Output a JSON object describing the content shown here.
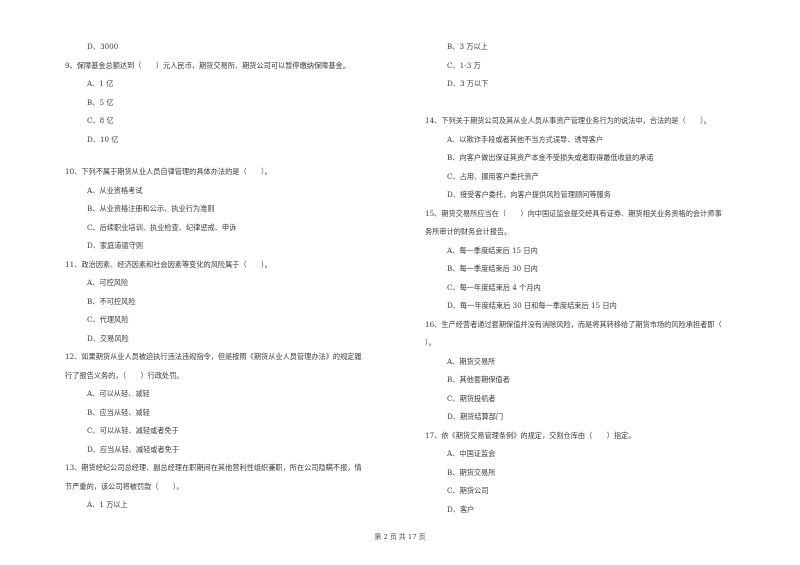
{
  "left_column": [
    {
      "text": "D、3000",
      "type": "option"
    },
    {
      "text": "9、保障基金总额达到（　　）元人民币，期货交易所、期货公司可以暂停缴纳保障基金。",
      "type": "question"
    },
    {
      "text": "A、1 亿",
      "type": "option"
    },
    {
      "text": "B、5 亿",
      "type": "option"
    },
    {
      "text": "C、8 亿",
      "type": "option"
    },
    {
      "text": "D、10 亿",
      "type": "option"
    },
    {
      "text": "10、下列不属于期货从业人员自律管理的具体办法的是（　　）。",
      "type": "question"
    },
    {
      "text": "A、从业资格考试",
      "type": "option"
    },
    {
      "text": "B、从业资格注册和公示、执业行为准则",
      "type": "option"
    },
    {
      "text": "C、后续职业培训、执业检查、纪律惩戒、申诉",
      "type": "option"
    },
    {
      "text": "D、家庭道德守则",
      "type": "option"
    },
    {
      "text": "11、政治因素、经济因素和社会因素等变化的风险属于（　　）。",
      "type": "question"
    },
    {
      "text": "A、可控风险",
      "type": "option"
    },
    {
      "text": "B、不可控风险",
      "type": "option"
    },
    {
      "text": "C、代理风险",
      "type": "option"
    },
    {
      "text": "D、交易风险",
      "type": "option"
    },
    {
      "text": "12、如果期货从业人员被迫执行违法违规指令，但是按照《期货从业人员管理办法》的规定履",
      "type": "question"
    },
    {
      "text": "行了报告义务的，（　　）行政处罚。",
      "type": "question-cont"
    },
    {
      "text": "A、可以从轻、减轻",
      "type": "option"
    },
    {
      "text": "B、应当从轻、减轻",
      "type": "option"
    },
    {
      "text": "C、可以从轻、减轻或者免于",
      "type": "option"
    },
    {
      "text": "D、应当从轻、减轻或者免于",
      "type": "option"
    },
    {
      "text": "13、期货经纪公司总经理、副总经理在职期间在其他营利性组织兼职，所在公司隐瞒不报，情",
      "type": "question"
    },
    {
      "text": "节严重的，该公司将被罚款（　　）。",
      "type": "question-cont"
    },
    {
      "text": "A、1 万以上",
      "type": "option"
    }
  ],
  "right_column": [
    {
      "text": "B、3 万以上",
      "type": "option"
    },
    {
      "text": "C、1-3 万",
      "type": "option"
    },
    {
      "text": "D、3 万以下",
      "type": "option"
    },
    {
      "text": "14、下列关于期货公司及其从业人员从事资产管理业务行为的说法中，合法的是（　　）。",
      "type": "question"
    },
    {
      "text": "A、以欺诈手段或者其他不当方式误导、诱导客户",
      "type": "option"
    },
    {
      "text": "B、向客户做出保证其资产本金不受损失或者取得最低收益的承诺",
      "type": "option"
    },
    {
      "text": "C、占用、挪用客户委托资产",
      "type": "option"
    },
    {
      "text": "D、接受客户委托，向客户提供风险管理顾问等服务",
      "type": "option"
    },
    {
      "text": "15、期货交易所应当在（　　）向中国证监会提交经具有证券、期货相关业务资格的会计师事",
      "type": "question"
    },
    {
      "text": "务所审计的财务会计报告。",
      "type": "question-cont"
    },
    {
      "text": "A、每一季度结束后 15 日内",
      "type": "option"
    },
    {
      "text": "B、每一季度结束后 30 日内",
      "type": "option"
    },
    {
      "text": "C、每一年度结束后 4 个月内",
      "type": "option"
    },
    {
      "text": "D、每一年度结束后 30 日和每一季度结束后 15 日内",
      "type": "option"
    },
    {
      "text": "16、生产经营者通过套期保值并没有消除风险，而是将其转移给了期货市场的风险承担者即（",
      "type": "question"
    },
    {
      "text": "）。",
      "type": "question-cont"
    },
    {
      "text": "A、期货交易所",
      "type": "option"
    },
    {
      "text": "B、其他套期保值者",
      "type": "option"
    },
    {
      "text": "C、期货投机者",
      "type": "option"
    },
    {
      "text": "D、期货结算部门",
      "type": "option"
    },
    {
      "text": "17、依《期货交易管理条例》的规定，交割仓库由（　　）指定。",
      "type": "question"
    },
    {
      "text": "A、中国证监会",
      "type": "option"
    },
    {
      "text": "B、期货交易所",
      "type": "option"
    },
    {
      "text": "C、期货公司",
      "type": "option"
    },
    {
      "text": "D、客户",
      "type": "option"
    }
  ],
  "footer": {
    "page_label": "第 2 页 共 17 页"
  }
}
